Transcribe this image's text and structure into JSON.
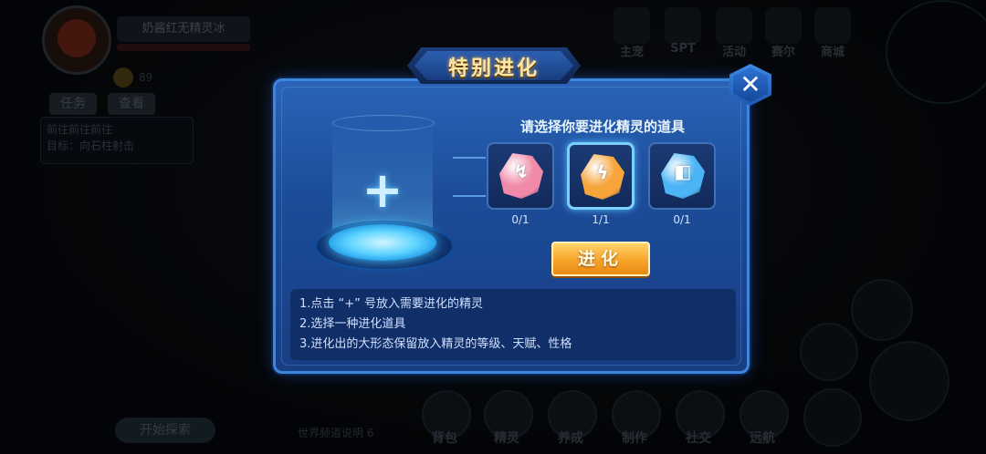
{
  "background_hud": {
    "player_name": "奶酱红无精灵冰",
    "player_hp": "20/20",
    "coin_value": "89",
    "tabs": [
      "任务",
      "查看"
    ],
    "quest_title": "前往前往前往",
    "quest_target": "目标：向石柱射击",
    "top_menu": [
      "主宠",
      "SPT",
      "活动",
      "赛尔",
      "商城"
    ],
    "bottom_menu": [
      "背包",
      "精灵",
      "养成",
      "制作",
      "社交",
      "远航"
    ],
    "explore_button": "开始探索",
    "world_label": "世界频道说明 6"
  },
  "dialog": {
    "title": "特别进化",
    "close_symbol": "✕",
    "add_symbol": "+",
    "prompt": "请选择你要进化精灵的道具",
    "items": [
      {
        "name": "pink-stone",
        "count": "0/1",
        "color": "#f08aa8",
        "glyph": "↯",
        "selected": false
      },
      {
        "name": "orange-stone",
        "count": "1/1",
        "color": "#f7a43a",
        "glyph": "ϟ",
        "selected": true
      },
      {
        "name": "blue-stone",
        "count": "0/1",
        "color": "#4ab4f4",
        "glyph": "◧",
        "selected": false
      }
    ],
    "evolve_button": "进化",
    "notes": [
      "1.点击 “+” 号放入需要进化的精灵",
      "2.选择一种进化道具",
      "3.进化出的大形态保留放入精灵的等级、天赋、性格"
    ]
  },
  "colors": {
    "dialog_bg": "#1c4c98",
    "dialog_border": "#3c86de",
    "button_orange": "#f7a42a",
    "title_gold": "#ffe7a6"
  }
}
